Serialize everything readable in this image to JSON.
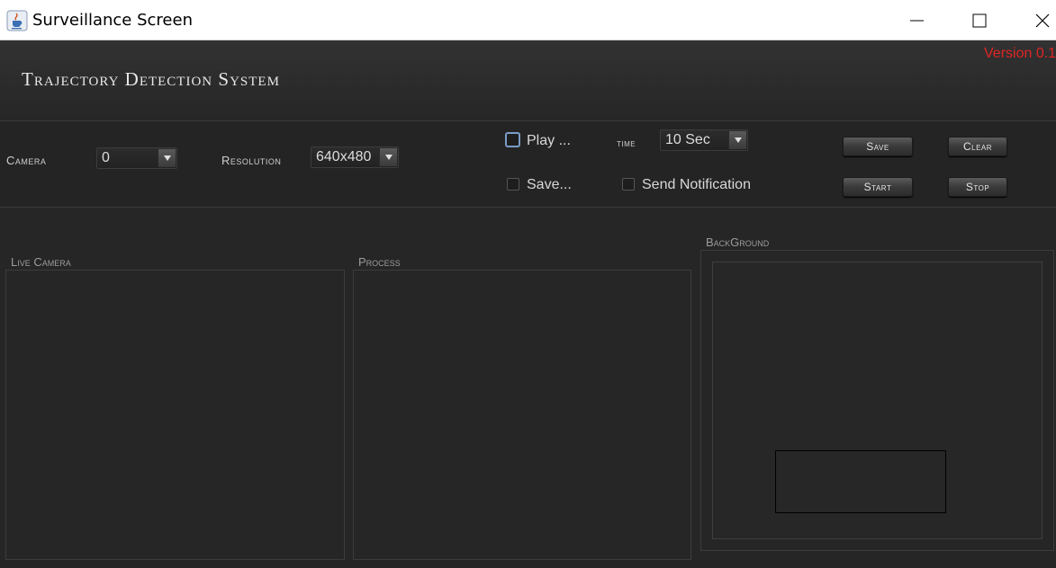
{
  "window": {
    "title": "Surveillance Screen",
    "icon": "java-cup-icon"
  },
  "header": {
    "title": "Trajectory Detection System",
    "version": "Version 0.1",
    "version_color": "#e02424"
  },
  "controls": {
    "camera_label": "Camera",
    "camera_value": "0",
    "resolution_label": "Resolution",
    "resolution_value": "640x480",
    "play_label": "Play ...",
    "save_check_label": "Save...",
    "time_label": "time",
    "time_value": "10 Sec",
    "send_notification_label": "Send Notification",
    "save_button": "Save",
    "clear_button": "Clear",
    "start_button": "Start",
    "stop_button": "Stop"
  },
  "panels": {
    "live_camera": "Live Camera",
    "process": "Process",
    "background": "BackGround"
  }
}
